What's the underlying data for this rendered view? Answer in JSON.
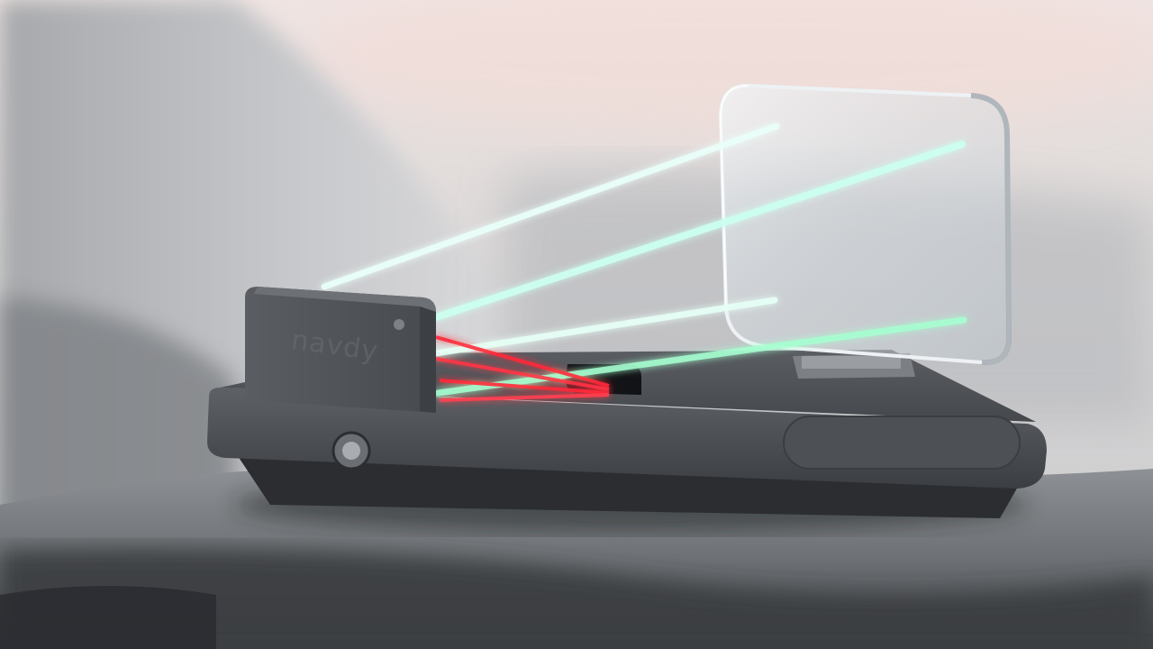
{
  "device": {
    "logo_text": "navdy"
  },
  "colors": {
    "beam_cyan": "#7fffe0",
    "beam_green": "#9effc9",
    "beam_red": "#ff2a3a",
    "device_body": "#4a4c50",
    "combiner_glass": "#dfe6ea"
  }
}
